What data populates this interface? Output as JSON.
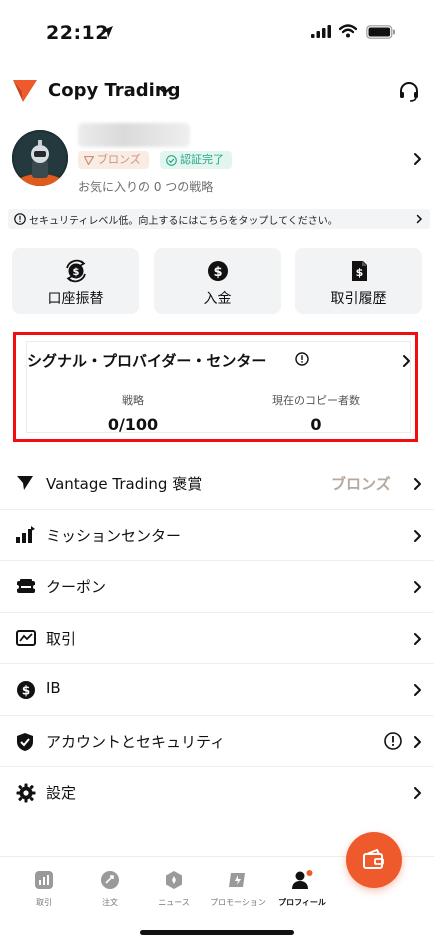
{
  "status_bar": {
    "time": "22:12"
  },
  "header": {
    "title": "Copy Trading"
  },
  "profile": {
    "tier_badge": "ブロンズ",
    "verified_badge": "認証完了",
    "favorites_text": "お気に入りの 0 つの戦略"
  },
  "security_banner": {
    "text": "セキュリティレベル低。向上するにはこちらをタップしてください。"
  },
  "quick_actions": [
    {
      "label": "口座振替",
      "icon": "transfer-icon"
    },
    {
      "label": "入金",
      "icon": "deposit-icon"
    },
    {
      "label": "取引履歴",
      "icon": "history-icon"
    }
  ],
  "signal_center": {
    "title": "シグナル・プロバイダー・センター",
    "strategies_label": "戦略",
    "strategies_value": "0/100",
    "copiers_label": "現在のコピー者数",
    "copiers_value": "0"
  },
  "menu": [
    {
      "label": "Vantage Trading 褒賞",
      "trail": "ブロンズ",
      "icon": "arrow-icon"
    },
    {
      "label": "ミッションセンター",
      "icon": "mission-icon"
    },
    {
      "label": "クーポン",
      "icon": "coupon-icon"
    },
    {
      "label": "取引",
      "icon": "chart-icon"
    },
    {
      "label": "IB",
      "icon": "dollar-icon"
    },
    {
      "label": "アカウントとセキュリティ",
      "icon": "shield-icon"
    },
    {
      "label": "設定",
      "icon": "gear-icon"
    }
  ],
  "tabs": [
    {
      "label": "取引",
      "icon": "bar-chart-icon"
    },
    {
      "label": "注文",
      "icon": "order-icon"
    },
    {
      "label": "ニュース",
      "icon": "news-icon"
    },
    {
      "label": "プロモーション",
      "icon": "promotion-icon"
    },
    {
      "label": "プロフィール",
      "icon": "profile-icon",
      "active": true
    }
  ],
  "colors": {
    "accent": "#ee5a2c",
    "highlight_border": "#f10d0d",
    "verified": "#24a585",
    "bronze": "#c99476"
  }
}
